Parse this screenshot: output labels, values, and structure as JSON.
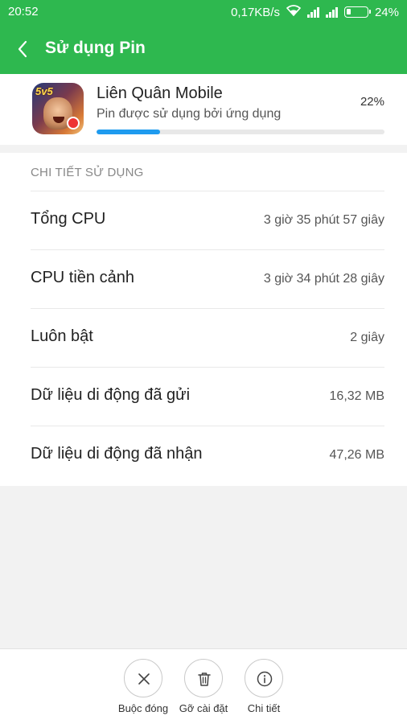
{
  "status_bar": {
    "time": "20:52",
    "network_speed": "0,17KB/s",
    "battery_percent": "24%",
    "battery_level": 0.24
  },
  "app_bar": {
    "back_icon": "chevron-left-icon",
    "title": "Sử dụng Pin"
  },
  "app": {
    "name": "Liên Quân Mobile",
    "subtitle": "Pin được sử dụng bởi ứng dụng",
    "percent_text": "22%",
    "usage_fraction": 0.22,
    "icon_badge": "5v5"
  },
  "details": {
    "header": "CHI TIẾT SỬ DỤNG",
    "rows": [
      {
        "label": "Tổng CPU",
        "value": "3 giờ 35 phút 57 giây"
      },
      {
        "label": "CPU tiền cảnh",
        "value": "3 giờ 34 phút 28 giây"
      },
      {
        "label": "Luôn bật",
        "value": "2 giây"
      },
      {
        "label": "Dữ liệu di động đã gửi",
        "value": "16,32 MB"
      },
      {
        "label": "Dữ liệu di động đã nhận",
        "value": "47,26 MB"
      }
    ]
  },
  "actions": [
    {
      "label": "Buộc đóng",
      "icon": "close-icon"
    },
    {
      "label": "Gỡ cài đặt",
      "icon": "trash-icon"
    },
    {
      "label": "Chi tiết",
      "icon": "info-icon"
    }
  ],
  "colors": {
    "primary_green": "#2eb84f",
    "progress_blue": "#1e9bef"
  }
}
